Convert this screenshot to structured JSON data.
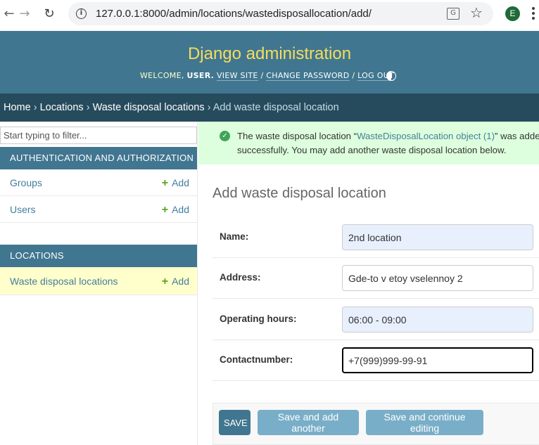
{
  "browser": {
    "url": "127.0.0.1:8000/admin/locations/wastedisposallocation/add/",
    "avatar_letter": "E",
    "icons": [
      "back-arrow-icon",
      "forward-arrow-icon",
      "reload-icon",
      "info-icon",
      "translate-icon",
      "star-icon",
      "kebab-menu-icon"
    ]
  },
  "header": {
    "site_title": "Django administration",
    "welcome": "WELCOME,",
    "username": "USER.",
    "view_site": "VIEW SITE",
    "change_password": "CHANGE PASSWORD",
    "log_out": "LOG OUT",
    "separator": "/"
  },
  "breadcrumbs": {
    "home": "Home",
    "app": "Locations",
    "model": "Waste disposal locations",
    "current": "Add waste disposal location",
    "sep": "›"
  },
  "sidebar": {
    "filter_placeholder": "Start typing to filter...",
    "modules": [
      {
        "caption": "AUTHENTICATION AND AUTHORIZATION",
        "models": [
          {
            "name": "Groups",
            "add": "Add"
          },
          {
            "name": "Users",
            "add": "Add"
          }
        ]
      },
      {
        "caption": "LOCATIONS",
        "models": [
          {
            "name": "Waste disposal locations",
            "add": "Add"
          }
        ]
      }
    ]
  },
  "message": {
    "line1_prefix": "The waste disposal location “",
    "object_link": "WasteDisposalLocation object (1)",
    "line1_suffix": "” was added",
    "line2": "successfully. You may add another waste disposal location below."
  },
  "content": {
    "title": "Add waste disposal location",
    "fields": [
      {
        "label": "Name:",
        "value": "2nd location"
      },
      {
        "label": "Address:",
        "value": "Gde-to v etoy vselennoy 2"
      },
      {
        "label": "Operating hours:",
        "value": "06:00 - 09:00"
      },
      {
        "label": "Contactnumber:",
        "value": "+7(999)999-99-91"
      }
    ]
  },
  "submit": {
    "save": "SAVE",
    "save_add_another": "Save and add another",
    "save_continue": "Save and continue editing"
  },
  "colors": {
    "header_bg": "#417690",
    "breadcrumb_bg": "#264b5d",
    "site_title": "#f5dd5d",
    "success_bg": "#ddffdd",
    "button": "#79aec8"
  }
}
